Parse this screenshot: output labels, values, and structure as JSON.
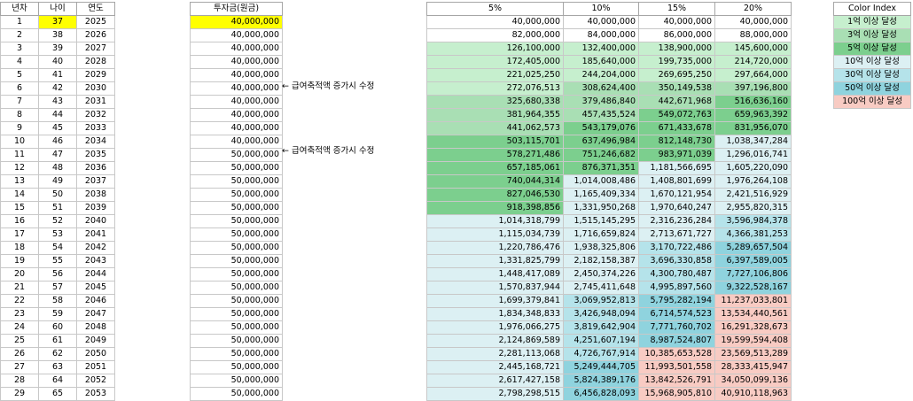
{
  "sheet": {
    "headers": {
      "year_idx": "년차",
      "age": "나이",
      "year": "연도",
      "investment": "투자금(원금)"
    },
    "rates": [
      "5%",
      "10%",
      "15%",
      "20%"
    ],
    "rows": [
      {
        "n": "1",
        "age": "37",
        "year": "2025",
        "inv": "40,000,000",
        "v": [
          "40,000,000",
          "40,000,000",
          "40,000,000",
          "40,000,000"
        ]
      },
      {
        "n": "2",
        "age": "38",
        "year": "2026",
        "inv": "40,000,000",
        "v": [
          "82,000,000",
          "84,000,000",
          "86,000,000",
          "88,000,000"
        ]
      },
      {
        "n": "3",
        "age": "39",
        "year": "2027",
        "inv": "40,000,000",
        "v": [
          "126,100,000",
          "132,400,000",
          "138,900,000",
          "145,600,000"
        ]
      },
      {
        "n": "4",
        "age": "40",
        "year": "2028",
        "inv": "40,000,000",
        "v": [
          "172,405,000",
          "185,640,000",
          "199,735,000",
          "214,720,000"
        ]
      },
      {
        "n": "5",
        "age": "41",
        "year": "2029",
        "inv": "40,000,000",
        "v": [
          "221,025,250",
          "244,204,000",
          "269,695,250",
          "297,664,000"
        ]
      },
      {
        "n": "6",
        "age": "42",
        "year": "2030",
        "inv": "40,000,000",
        "v": [
          "272,076,513",
          "308,624,400",
          "350,149,538",
          "397,196,800"
        ]
      },
      {
        "n": "7",
        "age": "43",
        "year": "2031",
        "inv": "40,000,000",
        "v": [
          "325,680,338",
          "379,486,840",
          "442,671,968",
          "516,636,160"
        ]
      },
      {
        "n": "8",
        "age": "44",
        "year": "2032",
        "inv": "40,000,000",
        "v": [
          "381,964,355",
          "457,435,524",
          "549,072,763",
          "659,963,392"
        ]
      },
      {
        "n": "9",
        "age": "45",
        "year": "2033",
        "inv": "40,000,000",
        "v": [
          "441,062,573",
          "543,179,076",
          "671,433,678",
          "831,956,070"
        ]
      },
      {
        "n": "10",
        "age": "46",
        "year": "2034",
        "inv": "40,000,000",
        "v": [
          "503,115,701",
          "637,496,984",
          "812,148,730",
          "1,038,347,284"
        ]
      },
      {
        "n": "11",
        "age": "47",
        "year": "2035",
        "inv": "50,000,000",
        "v": [
          "578,271,486",
          "751,246,682",
          "983,971,039",
          "1,296,016,741"
        ]
      },
      {
        "n": "12",
        "age": "48",
        "year": "2036",
        "inv": "50,000,000",
        "v": [
          "657,185,061",
          "876,371,351",
          "1,181,566,695",
          "1,605,220,090"
        ]
      },
      {
        "n": "13",
        "age": "49",
        "year": "2037",
        "inv": "50,000,000",
        "v": [
          "740,044,314",
          "1,014,008,486",
          "1,408,801,699",
          "1,976,264,108"
        ]
      },
      {
        "n": "14",
        "age": "50",
        "year": "2038",
        "inv": "50,000,000",
        "v": [
          "827,046,530",
          "1,165,409,334",
          "1,670,121,954",
          "2,421,516,929"
        ]
      },
      {
        "n": "15",
        "age": "51",
        "year": "2039",
        "inv": "50,000,000",
        "v": [
          "918,398,856",
          "1,331,950,268",
          "1,970,640,247",
          "2,955,820,315"
        ]
      },
      {
        "n": "16",
        "age": "52",
        "year": "2040",
        "inv": "50,000,000",
        "v": [
          "1,014,318,799",
          "1,515,145,295",
          "2,316,236,284",
          "3,596,984,378"
        ]
      },
      {
        "n": "17",
        "age": "53",
        "year": "2041",
        "inv": "50,000,000",
        "v": [
          "1,115,034,739",
          "1,716,659,824",
          "2,713,671,727",
          "4,366,381,253"
        ]
      },
      {
        "n": "18",
        "age": "54",
        "year": "2042",
        "inv": "50,000,000",
        "v": [
          "1,220,786,476",
          "1,938,325,806",
          "3,170,722,486",
          "5,289,657,504"
        ]
      },
      {
        "n": "19",
        "age": "55",
        "year": "2043",
        "inv": "50,000,000",
        "v": [
          "1,331,825,799",
          "2,182,158,387",
          "3,696,330,858",
          "6,397,589,005"
        ]
      },
      {
        "n": "20",
        "age": "56",
        "year": "2044",
        "inv": "50,000,000",
        "v": [
          "1,448,417,089",
          "2,450,374,226",
          "4,300,780,487",
          "7,727,106,806"
        ]
      },
      {
        "n": "21",
        "age": "57",
        "year": "2045",
        "inv": "50,000,000",
        "v": [
          "1,570,837,944",
          "2,745,411,648",
          "4,995,897,560",
          "9,322,528,167"
        ]
      },
      {
        "n": "22",
        "age": "58",
        "year": "2046",
        "inv": "50,000,000",
        "v": [
          "1,699,379,841",
          "3,069,952,813",
          "5,795,282,194",
          "11,237,033,801"
        ]
      },
      {
        "n": "23",
        "age": "59",
        "year": "2047",
        "inv": "50,000,000",
        "v": [
          "1,834,348,833",
          "3,426,948,094",
          "6,714,574,523",
          "13,534,440,561"
        ]
      },
      {
        "n": "24",
        "age": "60",
        "year": "2048",
        "inv": "50,000,000",
        "v": [
          "1,976,066,275",
          "3,819,642,904",
          "7,771,760,702",
          "16,291,328,673"
        ]
      },
      {
        "n": "25",
        "age": "61",
        "year": "2049",
        "inv": "50,000,000",
        "v": [
          "2,124,869,589",
          "4,251,607,194",
          "8,987,524,807",
          "19,599,594,408"
        ]
      },
      {
        "n": "26",
        "age": "62",
        "year": "2050",
        "inv": "50,000,000",
        "v": [
          "2,281,113,068",
          "4,726,767,914",
          "10,385,653,528",
          "23,569,513,289"
        ]
      },
      {
        "n": "27",
        "age": "63",
        "year": "2051",
        "inv": "50,000,000",
        "v": [
          "2,445,168,721",
          "5,249,444,705",
          "11,993,501,558",
          "28,333,415,947"
        ]
      },
      {
        "n": "28",
        "age": "64",
        "year": "2052",
        "inv": "50,000,000",
        "v": [
          "2,617,427,158",
          "5,824,389,176",
          "13,842,526,791",
          "34,050,099,136"
        ]
      },
      {
        "n": "29",
        "age": "65",
        "year": "2053",
        "inv": "50,000,000",
        "v": [
          "2,798,298,515",
          "6,456,828,093",
          "15,968,905,810",
          "40,910,118,963"
        ]
      }
    ],
    "notes": [
      {
        "row": 6,
        "text": "← 급여축적액 증가시 수정"
      },
      {
        "row": 11,
        "text": "← 급여축적액 증가시 수정"
      }
    ],
    "highlight_color": "#ffff00"
  },
  "legend": {
    "title": "Color Index",
    "items": [
      {
        "label": "1억 이상 달성",
        "color": "#c6efce"
      },
      {
        "label": "3억 이상 달성",
        "color": "#a9dfb4"
      },
      {
        "label": "5억 이상 달성",
        "color": "#7ccf8e"
      },
      {
        "label": "10억 이상 달성",
        "color": "#dcf0f3"
      },
      {
        "label": "30억 이상 달성",
        "color": "#b5e3ea"
      },
      {
        "label": "50억 이상 달성",
        "color": "#8fd3de"
      },
      {
        "label": "100억 이상 달성",
        "color": "#f8cbc3"
      }
    ]
  }
}
